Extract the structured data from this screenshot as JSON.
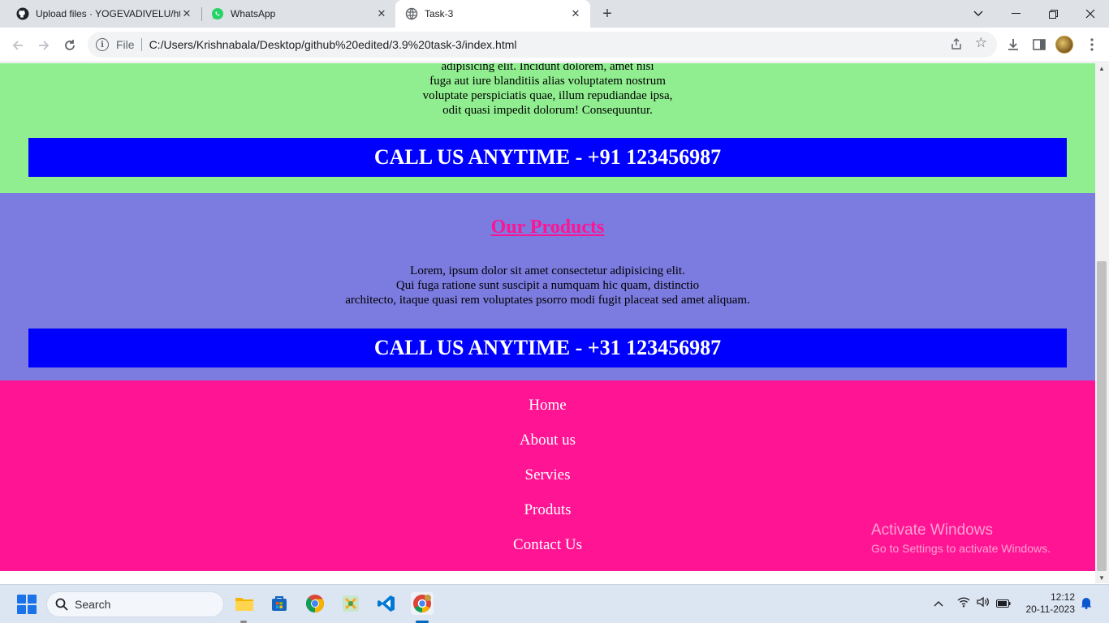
{
  "browser": {
    "tabs": [
      {
        "title": "Upload files · YOGEVADIVELU/ht",
        "icon": "github-icon",
        "active": false
      },
      {
        "title": "WhatsApp",
        "icon": "whatsapp-icon",
        "active": false
      },
      {
        "title": "Task-3",
        "icon": "globe-icon",
        "active": true
      }
    ],
    "address": {
      "scheme_label": "File",
      "url": "C:/Users/Krishnabala/Desktop/github%20edited/3.9%20task-3/index.html"
    }
  },
  "page": {
    "intro_lines": [
      "adipisicing elit. Incidunt dolorem, amet nisi",
      "fuga aut iure blanditiis alias voluptatem nostrum",
      "voluptate perspiciatis quae, illum repudiandae ipsa,",
      "odit quasi impedit dolorum! Consequuntur."
    ],
    "call_us_1": "CALL US ANYTIME - +91 123456987",
    "products": {
      "title": "Our Products",
      "lines": [
        "Lorem, ipsum dolor sit amet consectetur adipisicing elit.",
        "Qui fuga ratione sunt suscipit a numquam hic quam, distinctio",
        "architecto, itaque quasi rem voluptates psorro modi fugit placeat sed amet aliquam."
      ]
    },
    "call_us_2": "CALL US ANYTIME - +31 123456987",
    "footer_links": [
      "Home",
      "About us",
      "Servies",
      "Produts",
      "Contact Us"
    ],
    "colors": {
      "green_section": "#90ee90",
      "purple_section": "#7b7be0",
      "pink_section": "#ff1493",
      "call_bar": "#0000ff"
    }
  },
  "watermark": {
    "title": "Activate Windows",
    "subtitle": "Go to Settings to activate Windows."
  },
  "taskbar": {
    "search_label": "Search",
    "time": "12:12",
    "date": "20-11-2023"
  }
}
